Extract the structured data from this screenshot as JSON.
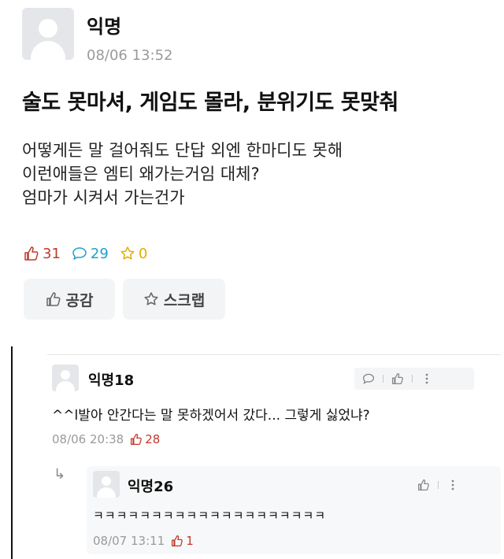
{
  "post": {
    "author": "익명",
    "time": "08/06 13:52",
    "title": "술도 못마셔, 게임도 몰라, 분위기도 못맞춰",
    "body_lines": [
      "어떻게든 말 걸어줘도 단답 외엔 한마디도 못해",
      "이런애들은 엠티 왜가는거임 대체?",
      "엄마가 시켜서 가는건가"
    ],
    "stats": {
      "likes": "31",
      "comments": "29",
      "scraps": "0"
    },
    "buttons": {
      "like": "공감",
      "scrap": "스크랩"
    }
  },
  "comments": [
    {
      "author": "익명18",
      "text": "^^l발아 안간다는 말 못하겠어서 갔다...  그렇게 싫었냐?",
      "time": "08/06 20:38",
      "likes": "28"
    }
  ],
  "reply": {
    "author": "익명26",
    "text": "ㅋㅋㅋㅋㅋㅋㅋㅋㅋㅋㅋㅋㅋㅋㅋㅋㅋㅋㅋㅋ",
    "time": "08/07 13:11",
    "likes": "1",
    "arrow": "↳"
  },
  "colors": {
    "like": "#c0392b",
    "comment": "#1fa0c8",
    "scrap": "#e0b000",
    "muted": "#9a9a9a"
  },
  "icons": [
    "avatar-placeholder",
    "thumbs-up-icon",
    "speech-bubble-icon",
    "star-icon",
    "more-vertical-icon",
    "reply-arrow-icon"
  ]
}
